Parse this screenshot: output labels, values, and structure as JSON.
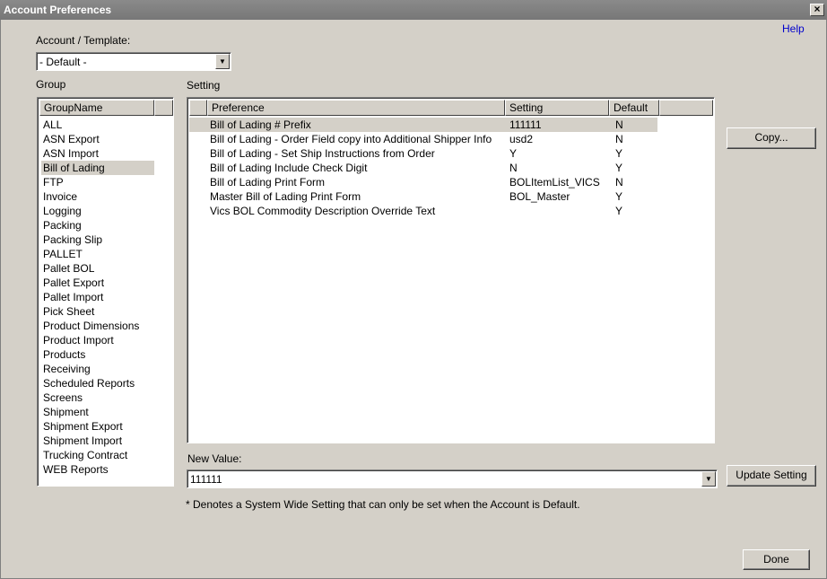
{
  "window": {
    "title": "Account Preferences",
    "close_label": "×"
  },
  "help_label": "Help",
  "account": {
    "label": "Account / Template:",
    "value": "- Default -"
  },
  "group": {
    "label": "Group",
    "column": "GroupName",
    "items": [
      "ALL",
      "ASN Export",
      "ASN Import",
      "Bill of Lading",
      "FTP",
      "Invoice",
      "Logging",
      "Packing",
      "Packing Slip",
      "PALLET",
      "Pallet BOL",
      "Pallet Export",
      "Pallet Import",
      "Pick Sheet",
      "Product Dimensions",
      "Product Import",
      "Products",
      "Receiving",
      "Scheduled Reports",
      "Screens",
      "Shipment",
      "Shipment Export",
      "Shipment Import",
      "Trucking Contract",
      "WEB Reports"
    ],
    "selected": "Bill of Lading"
  },
  "setting": {
    "label": "Setting",
    "columns": {
      "preference": "Preference",
      "setting": "Setting",
      "default": "Default"
    },
    "rows": [
      {
        "preference": "Bill of Lading # Prefix",
        "setting": "111111",
        "default": "N"
      },
      {
        "preference": "Bill of Lading - Order Field copy into Additional Shipper Info",
        "setting": "usd2",
        "default": "N"
      },
      {
        "preference": "Bill of Lading - Set Ship Instructions from Order",
        "setting": "Y",
        "default": "Y"
      },
      {
        "preference": "Bill of Lading Include Check Digit",
        "setting": "N",
        "default": "Y"
      },
      {
        "preference": "Bill of Lading Print Form",
        "setting": "BOLItemList_VICS",
        "default": "N"
      },
      {
        "preference": "Master Bill of Lading Print Form",
        "setting": "BOL_Master",
        "default": "Y"
      },
      {
        "preference": "Vics BOL Commodity Description Override Text",
        "setting": "",
        "default": "Y"
      }
    ]
  },
  "new_value": {
    "label": "New Value:",
    "value": "111111"
  },
  "footnote": "* Denotes a System Wide Setting that can only be set when the Account is Default.",
  "buttons": {
    "copy": "Copy...",
    "update": "Update Setting",
    "done": "Done"
  }
}
